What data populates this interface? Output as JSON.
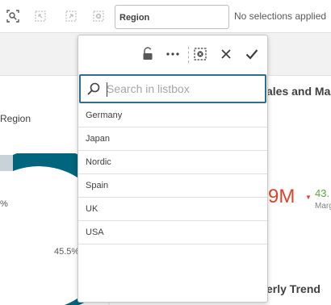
{
  "toolbar": {
    "icons": [
      "smart-search-icon",
      "step-back-icon",
      "step-forward-icon",
      "clear-selections-icon"
    ],
    "field_label": "Region",
    "no_selections": "No selections applied"
  },
  "left_chart": {
    "title": "Region",
    "label_small": "%",
    "label_big": "45.5%"
  },
  "right_panel": {
    "title": "ales and Ma",
    "kpi_value": "9M",
    "kpi_change": "43.",
    "kpi_sub": "Marg",
    "trend_title": "erly Trend"
  },
  "listbox": {
    "toolbar_icons": [
      "unlock-icon",
      "more-icon",
      "clear-selection-icon",
      "cancel-icon",
      "confirm-icon"
    ],
    "search_placeholder": "Search in listbox",
    "items": [
      "Germany",
      "Japan",
      "Nordic",
      "Spain",
      "UK",
      "USA"
    ]
  },
  "colors": {
    "accent": "#2e6f8e",
    "donut_teal": "#00657d",
    "donut_gray": "#c9d1d9",
    "kpi_red": "#e0402d",
    "kpi_green": "#5aab3c"
  }
}
